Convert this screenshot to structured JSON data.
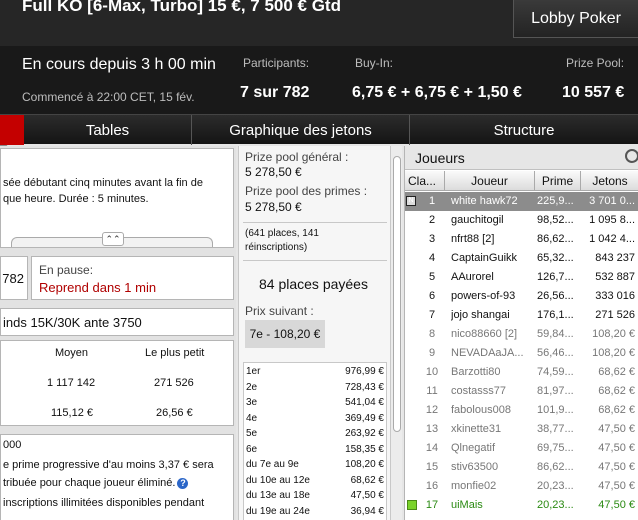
{
  "header": {
    "title": "Full KO [6-Max, Turbo] 15 €, 7 500 € Gtd",
    "lobby_button": "Lobby Poker"
  },
  "info": {
    "running": "En cours depuis 3 h 00 min",
    "started": "Commencé à 22:00 CET, 15 fév.",
    "participants_label": "Participants:",
    "participants_value": "7 sur 782",
    "buyin_label": "Buy-In:",
    "buyin_value": "6,75 € + 6,75 € + 1,50 €",
    "prizepool_label": "Prize Pool:",
    "prizepool_value": "10 557 €"
  },
  "tabs": [
    {
      "label": "Tables"
    },
    {
      "label": "Graphique des jetons"
    },
    {
      "label": "Structure"
    }
  ],
  "left": {
    "desc_line1": "sée débutant cinq minutes avant la fin de",
    "desc_line2": "que heure. Durée : 5 minutes.",
    "count": "782",
    "pause_label": "En pause:",
    "pause_value": "Reprend dans 1 min",
    "blinds": "inds 15K/30K ante 3750",
    "stats_header_avg": "Moyen",
    "stats_header_min": "Le plus petit",
    "stats_row1_avg": "1 117 142",
    "stats_row1_min": "271 526",
    "stats_row2_avg": "115,12 €",
    "stats_row2_min": "26,56 €",
    "bounty_line0": "000",
    "bounty_line1": "e prime progressive d'au moins 3,37 € sera",
    "bounty_line2": "tribuée pour chaque joueur éliminé.",
    "bounty_line3": "inscriptions illimitées disponibles pendant"
  },
  "middle": {
    "general_label": "Prize pool général :",
    "general_value": "5 278,50 €",
    "bounty_label": "Prize pool des primes :",
    "bounty_value": "5 278,50 €",
    "places_line1": "(641 places, 141",
    "places_line2": "réinscriptions)",
    "paid": "84 places payées",
    "next_label": "Prix suivant :",
    "next_value": "7e - 108,20 €",
    "payouts": [
      {
        "place": "1er",
        "amount": "976,99 €"
      },
      {
        "place": "2e",
        "amount": "728,43 €"
      },
      {
        "place": "3e",
        "amount": "541,04 €"
      },
      {
        "place": "4e",
        "amount": "369,49 €"
      },
      {
        "place": "5e",
        "amount": "263,92 €"
      },
      {
        "place": "6e",
        "amount": "158,35 €"
      },
      {
        "place": "du 7e au 9e",
        "amount": "108,20 €"
      },
      {
        "place": "du 10e au 12e",
        "amount": "68,62 €"
      },
      {
        "place": "du 13e au 18e",
        "amount": "47,50 €"
      },
      {
        "place": "du 19e au 24e",
        "amount": "36,94 €"
      }
    ]
  },
  "players": {
    "title": "Joueurs",
    "col_rank": "Cla...",
    "col_name": "Joueur",
    "col_prime": "Prime",
    "col_chips": "Jetons",
    "rows": [
      {
        "rank": "1",
        "name": "white hawk72",
        "prime": "225,9...",
        "chips": "3 701 0..."
      },
      {
        "rank": "2",
        "name": "gauchitogil",
        "prime": "98,52...",
        "chips": "1 095 8..."
      },
      {
        "rank": "3",
        "name": "nfrt88 [2]",
        "prime": "86,62...",
        "chips": "1 042 4..."
      },
      {
        "rank": "4",
        "name": "CaptainGuikk",
        "prime": "65,32...",
        "chips": "843 237"
      },
      {
        "rank": "5",
        "name": "AAurorel",
        "prime": "126,7...",
        "chips": "532 887"
      },
      {
        "rank": "6",
        "name": "powers-of-93",
        "prime": "26,56...",
        "chips": "333 016"
      },
      {
        "rank": "7",
        "name": "jojo shangai",
        "prime": "176,1...",
        "chips": "271 526"
      },
      {
        "rank": "8",
        "name": "nico88660 [2]",
        "prime": "59,84...",
        "chips": "108,20 €"
      },
      {
        "rank": "9",
        "name": "NEVADAaJA...",
        "prime": "56,46...",
        "chips": "108,20 €"
      },
      {
        "rank": "10",
        "name": "Barzotti80",
        "prime": "74,59...",
        "chips": "68,62 €"
      },
      {
        "rank": "11",
        "name": "costasss77",
        "prime": "81,97...",
        "chips": "68,62 €"
      },
      {
        "rank": "12",
        "name": "fabolous008",
        "prime": "101,9...",
        "chips": "68,62 €"
      },
      {
        "rank": "13",
        "name": "xkinette31",
        "prime": "38,77...",
        "chips": "47,50 €"
      },
      {
        "rank": "14",
        "name": "Qlnegatif",
        "prime": "69,75...",
        "chips": "47,50 €"
      },
      {
        "rank": "15",
        "name": "stiv63500",
        "prime": "86,62...",
        "chips": "47,50 €"
      },
      {
        "rank": "16",
        "name": "monfie02",
        "prime": "20,23...",
        "chips": "47,50 €"
      },
      {
        "rank": "17",
        "name": "uiMais",
        "prime": "20,23...",
        "chips": "47,50 €"
      }
    ],
    "row_tag": "N"
  },
  "colors": {
    "selected_row": "#8c8c8c",
    "eliminated_text": "#777777",
    "current_user_text": "#2a8a12",
    "pause_text": "#b00000",
    "tab_accent": "#c40000"
  }
}
